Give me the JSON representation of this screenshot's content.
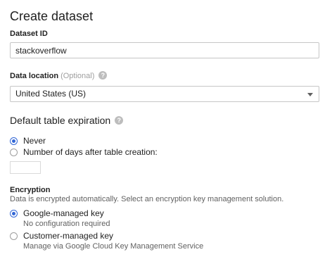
{
  "title": "Create dataset",
  "dataset_id": {
    "label": "Dataset ID",
    "value": "stackoverflow"
  },
  "data_location": {
    "label": "Data location",
    "optional": "(Optional)",
    "selected": "United States (US)"
  },
  "table_expiration": {
    "heading": "Default table expiration",
    "options": [
      {
        "label": "Never",
        "checked": true
      },
      {
        "label": "Number of days after table creation:",
        "checked": false
      }
    ],
    "days_value": ""
  },
  "encryption": {
    "heading": "Encryption",
    "description": "Data is encrypted automatically. Select an encryption key management solution.",
    "options": [
      {
        "label": "Google-managed key",
        "sublabel": "No configuration required",
        "checked": true
      },
      {
        "label": "Customer-managed key",
        "sublabel": "Manage via Google Cloud Key Management Service",
        "checked": false
      }
    ]
  },
  "colors": {
    "accent": "#3367d6",
    "border": "#c6c6c6"
  }
}
